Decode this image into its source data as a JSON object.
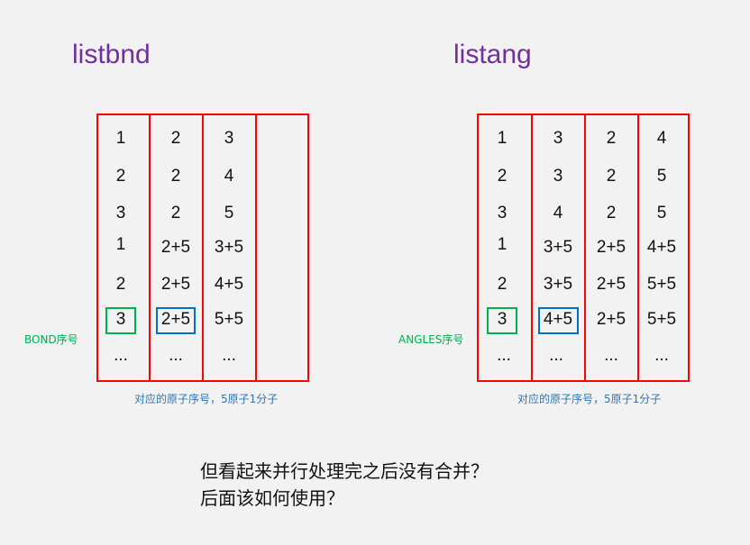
{
  "left": {
    "title": "listbnd",
    "side_label": "BOND序号",
    "under_label": "对应的原子序号，5原子1分子",
    "columns": [
      [
        "1",
        "2",
        "3",
        "1",
        "2",
        "3",
        "..."
      ],
      [
        "2",
        "2",
        "2",
        "2+5",
        "2+5",
        "2+5",
        "..."
      ],
      [
        "3",
        "4",
        "5",
        "3+5",
        "4+5",
        "5+5",
        "..."
      ],
      []
    ]
  },
  "right": {
    "title": "listang",
    "side_label": "ANGLES序号",
    "under_label": "对应的原子序号，5原子1分子",
    "columns": [
      [
        "1",
        "2",
        "3",
        "1",
        "2",
        "3",
        "..."
      ],
      [
        "3",
        "3",
        "4",
        "3+5",
        "3+5",
        "4+5",
        "..."
      ],
      [
        "2",
        "2",
        "2",
        "2+5",
        "2+5",
        "2+5",
        "..."
      ],
      [
        "4",
        "5",
        "5",
        "4+5",
        "5+5",
        "5+5",
        "..."
      ]
    ]
  },
  "question": {
    "line1": "但看起来并行处理完之后没有合并？",
    "line2": "后面该如何使用？"
  },
  "colors": {
    "title": "#7030a0",
    "table_border": "#ff0000",
    "highlight_green": "#00b050",
    "highlight_blue": "#0070c0",
    "label_blue": "#2e75b6"
  }
}
